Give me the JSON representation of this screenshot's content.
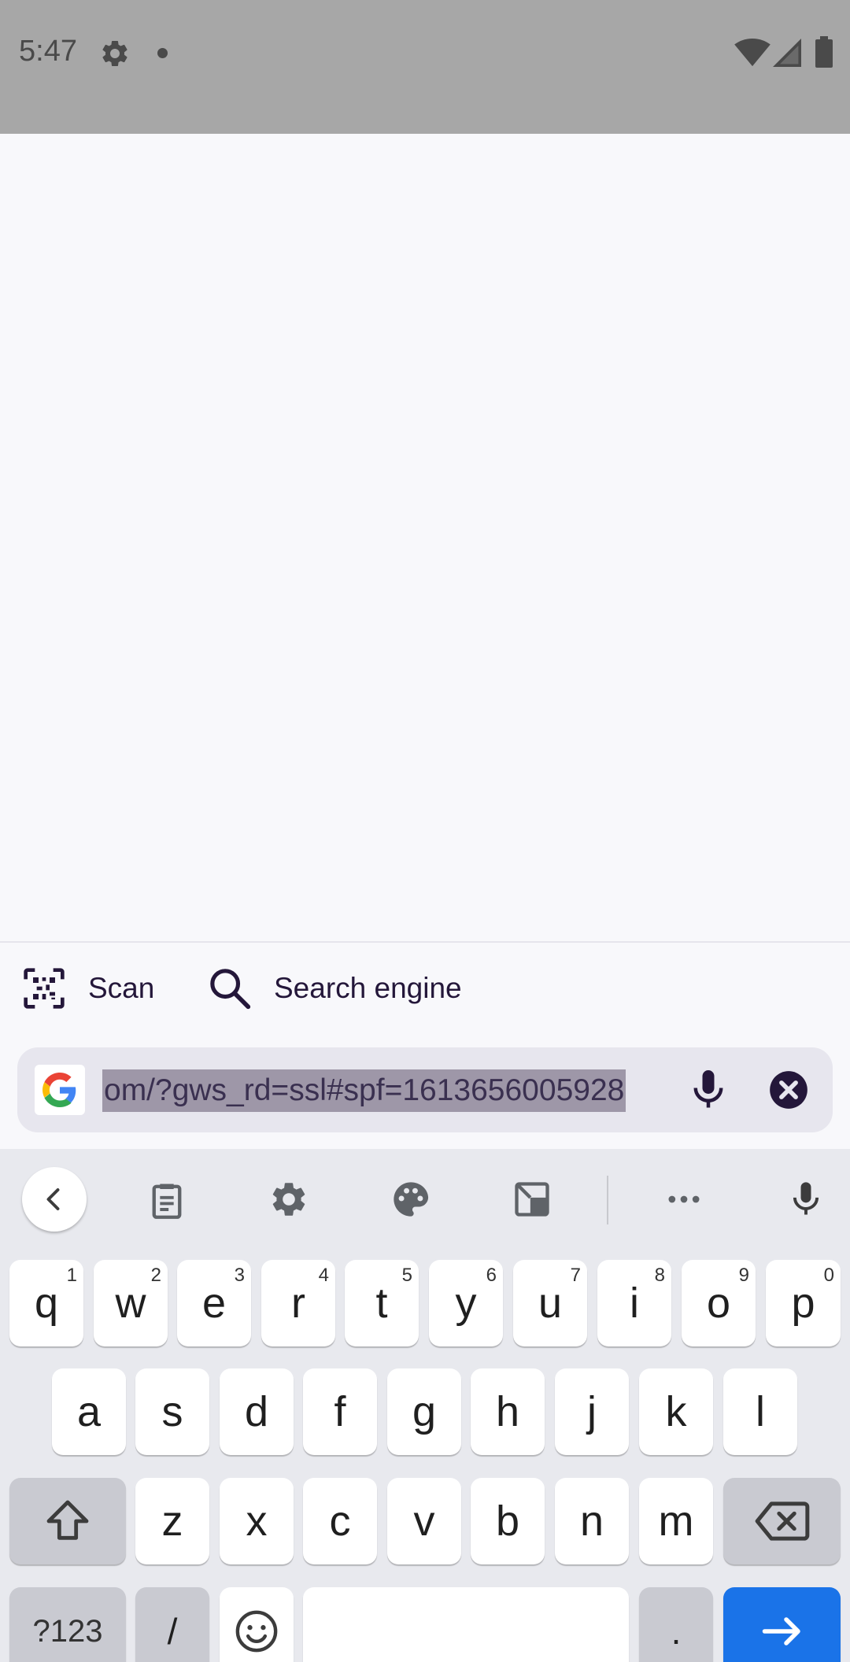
{
  "status_bar": {
    "time": "5:47",
    "icons": [
      "gear-icon",
      "notification-dot",
      "wifi-icon",
      "signal-icon",
      "battery-icon"
    ]
  },
  "suggestions": {
    "scan_label": "Scan",
    "search_engine_label": "Search engine"
  },
  "url_bar": {
    "engine_icon": "google-g-icon",
    "url_text": "om/?gws_rd=ssl#spf=1613656005928",
    "selected": true
  },
  "keyboard": {
    "toolbar_icons": [
      "back-chevron-icon",
      "clipboard-icon",
      "settings-icon",
      "palette-icon",
      "resize-icon",
      "more-icon",
      "mic-icon"
    ],
    "row1": [
      {
        "k": "q",
        "h": "1"
      },
      {
        "k": "w",
        "h": "2"
      },
      {
        "k": "e",
        "h": "3"
      },
      {
        "k": "r",
        "h": "4"
      },
      {
        "k": "t",
        "h": "5"
      },
      {
        "k": "y",
        "h": "6"
      },
      {
        "k": "u",
        "h": "7"
      },
      {
        "k": "i",
        "h": "8"
      },
      {
        "k": "o",
        "h": "9"
      },
      {
        "k": "p",
        "h": "0"
      }
    ],
    "row2": [
      "a",
      "s",
      "d",
      "f",
      "g",
      "h",
      "j",
      "k",
      "l"
    ],
    "row3": [
      "z",
      "x",
      "c",
      "v",
      "b",
      "n",
      "m"
    ],
    "symbols_label": "?123",
    "slash_label": "/",
    "period_label": "."
  },
  "colors": {
    "status_bar": "#a7a7a7",
    "accent": "#1a73e8",
    "url_bar_bg": "#e7e6ee",
    "selection": "#9e97a8",
    "text_dark": "#24173a"
  }
}
